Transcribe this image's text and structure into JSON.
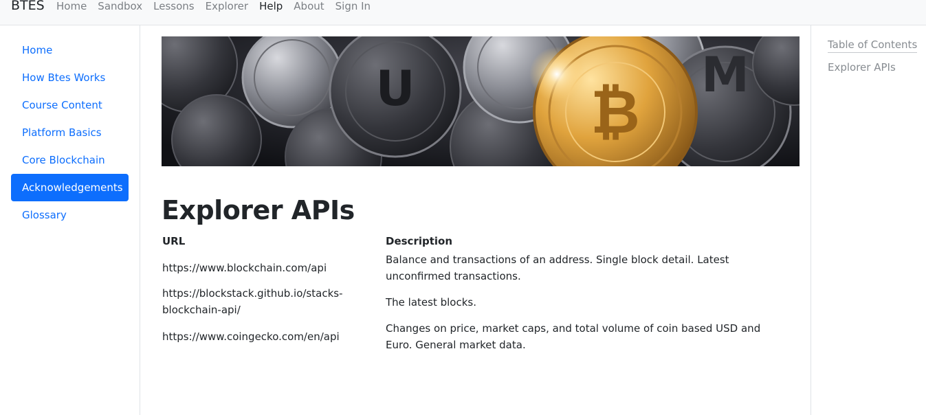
{
  "navbar": {
    "brand": "BTES",
    "links": [
      "Home",
      "Sandbox",
      "Lessons",
      "Explorer",
      "Help",
      "About",
      "Sign In"
    ],
    "active_link": "Help"
  },
  "sidebar": {
    "items": [
      {
        "label": "Home"
      },
      {
        "label": "How Btes Works"
      },
      {
        "label": "Course Content"
      },
      {
        "label": "Platform Basics"
      },
      {
        "label": "Core Blockchain"
      },
      {
        "label": "Acknowledgements",
        "active": true
      },
      {
        "label": "Glossary"
      }
    ]
  },
  "main": {
    "title": "Explorer APIs",
    "table": {
      "headers": [
        "URL",
        "Description"
      ],
      "rows": [
        {
          "url": "https://www.blockchain.com/api",
          "description": "Balance and transactions of an address. Single block detail. Latest unconfirmed transactions."
        },
        {
          "url": "https://blockstack.github.io/stacks-blockchain-api/",
          "description": "The latest blocks."
        },
        {
          "url": "https://www.coingecko.com/en/api",
          "description": "Changes on price, market caps, and total volume of coin based USD and Euro. General market data."
        }
      ]
    }
  },
  "toc": {
    "title": "Table of Contents",
    "links": [
      "Explorer APIs"
    ]
  },
  "colors": {
    "primary": "#0d6efd",
    "navbar_bg": "#f8f9fa",
    "muted": "#7b7f84"
  }
}
